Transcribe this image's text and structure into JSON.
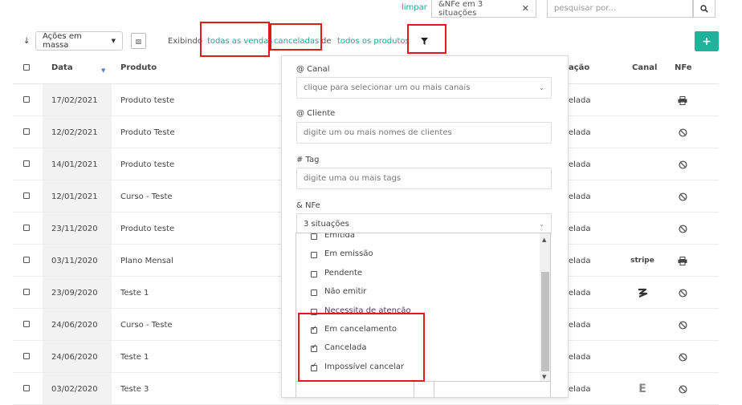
{
  "search": {
    "clear_label": "limpar",
    "active_filter_chip": "&NFe em 3 situações",
    "chip_close": "✕",
    "placeholder": "pesquisar por..."
  },
  "toolbar": {
    "sort_glyph": "↓",
    "bulk_actions_label": "Ações em massa",
    "showing_label": "Exibindo",
    "all_sales": "todas as vendas",
    "canceled": "canceladas",
    "of_label": "de",
    "all_products": "todos os produtos",
    "add_glyph": "+"
  },
  "table": {
    "headers": {
      "date": "Data",
      "product": "Produto",
      "status": "ação",
      "channel": "Canal",
      "nfe": "NFe"
    },
    "rows": [
      {
        "date": "17/02/2021",
        "product": "Produto teste",
        "status": "elada",
        "channel_icon": "",
        "nfe_icon": "printer-icon"
      },
      {
        "date": "12/02/2021",
        "product": "Produto Teste",
        "status": "elada",
        "channel_icon": "",
        "nfe_icon": "blocked-icon"
      },
      {
        "date": "14/01/2021",
        "product": "Produto teste",
        "status": "elada",
        "channel_icon": "",
        "nfe_icon": "blocked-icon"
      },
      {
        "date": "12/01/2021",
        "product": "Curso - Teste",
        "status": "elada",
        "channel_icon": "",
        "nfe_icon": "blocked-icon"
      },
      {
        "date": "23/11/2020",
        "product": "Produto teste",
        "status": "elada",
        "channel_icon": "",
        "nfe_icon": "blocked-icon"
      },
      {
        "date": "03/11/2020",
        "product": "Plano Mensal",
        "status": "elada",
        "channel_icon": "stripe",
        "nfe_icon": "printer-icon"
      },
      {
        "date": "23/09/2020",
        "product": "Teste 1",
        "status": "elada",
        "channel_icon": "swirl-logo",
        "nfe_icon": "blocked-icon"
      },
      {
        "date": "24/06/2020",
        "product": "Curso - Teste",
        "status": "elada",
        "channel_icon": "",
        "nfe_icon": "blocked-icon"
      },
      {
        "date": "24/06/2020",
        "product": "Teste 1",
        "status": "elada",
        "channel_icon": "",
        "nfe_icon": "blocked-icon"
      },
      {
        "date": "03/02/2020",
        "product": "Teste 3",
        "status": "elada",
        "channel_icon": "E",
        "nfe_icon": "blocked-icon"
      }
    ]
  },
  "filter_panel": {
    "channel_label": "@ Canal",
    "channel_placeholder": "clique para selecionar um ou mais canais",
    "client_label": "@ Cliente",
    "client_placeholder": "digite um ou mais nomes de clientes",
    "tag_label": "# Tag",
    "tag_placeholder": "digite uma ou mais tags",
    "nfe_label": "& NFe",
    "nfe_selected": "3 situações",
    "nfe_options": [
      {
        "label": "Emitida",
        "checked": false
      },
      {
        "label": "Em emissão",
        "checked": false
      },
      {
        "label": "Pendente",
        "checked": false
      },
      {
        "label": "Não emitir",
        "checked": false
      },
      {
        "label": "Necessita de atenção",
        "checked": false
      },
      {
        "label": "Em cancelamento",
        "checked": true
      },
      {
        "label": "Cancelada",
        "checked": true
      },
      {
        "label": "Impossível cancelar",
        "checked": true
      }
    ]
  },
  "colors": {
    "accent": "#1fa594",
    "add_button": "#1fb39c",
    "highlight": "#e01b1b"
  }
}
